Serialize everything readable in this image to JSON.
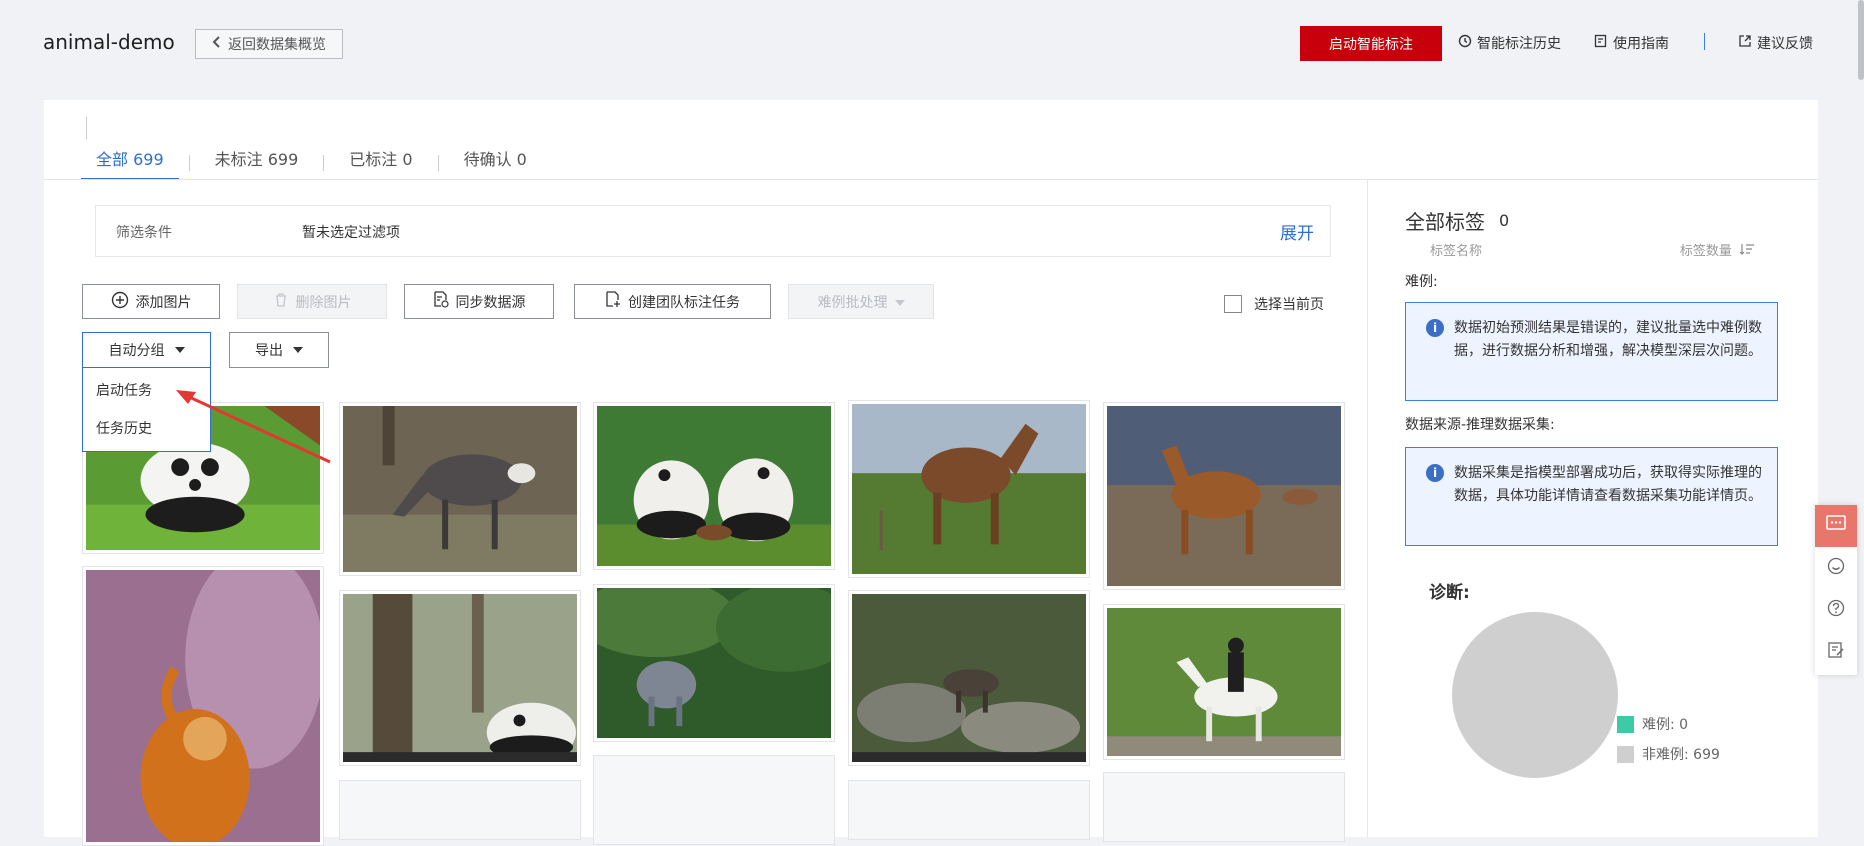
{
  "header": {
    "app_title": "animal-demo",
    "back_label": "返回数据集概览",
    "start_smart_label": "启动智能标注",
    "history_label": "智能标注历史",
    "guide_label": "使用指南",
    "feedback_label": "建议反馈"
  },
  "tabs": [
    {
      "label": "全部 699",
      "active": true
    },
    {
      "label": "未标注 699",
      "active": false
    },
    {
      "label": "已标注 0",
      "active": false
    },
    {
      "label": "待确认 0",
      "active": false
    }
  ],
  "filter": {
    "label": "筛选条件",
    "value": "暂未选定过滤项",
    "expand_label": "展开"
  },
  "toolbar": {
    "add_image": "添加图片",
    "delete_image": "删除图片",
    "sync_source": "同步数据源",
    "create_team_task": "创建团队标注任务",
    "hard_batch": "难例批处理",
    "select_page": "选择当前页",
    "auto_group": "自动分组",
    "export": "导出"
  },
  "menu": {
    "items": [
      "启动任务",
      "任务历史"
    ]
  },
  "images": [
    {
      "subject": "panda"
    },
    {
      "subject": "muntjac"
    },
    {
      "subject": "two-pandas"
    },
    {
      "subject": "horse-brown"
    },
    {
      "subject": "horse-chestnut"
    },
    {
      "subject": "golden-monkey"
    },
    {
      "subject": "panda-forest"
    },
    {
      "subject": "serow-forest"
    },
    {
      "subject": "muntjac-rocks"
    },
    {
      "subject": "white-horse-rider"
    }
  ],
  "right_panel": {
    "title": "全部标签",
    "count": "0",
    "col_name": "标签名称",
    "col_count": "标签数量",
    "hard_title": "难例:",
    "hard_info": "数据初始预测结果是错误的，建议批量选中难例数据，进行数据分析和增强，解决模型深层次问题。",
    "source_title": "数据来源-推理数据采集:",
    "source_info": "数据采集是指模型部署成功后，获取得实际推理的数据，具体功能详情请查看数据采集功能详情页。",
    "diag_title": "诊断:",
    "legend_hard": "难例: 0",
    "legend_non_hard": "非难例: 699"
  },
  "colors": {
    "primary": "#c7000b",
    "link": "#2f6fd4",
    "info_border": "#3a7ee8",
    "legend_hard": "#3ec9a7",
    "legend_non_hard": "#cfcfcf",
    "annotation_arrow": "#e3372f"
  },
  "chart_data": {
    "type": "pie",
    "categories": [
      "难例",
      "非难例"
    ],
    "values": [
      0,
      699
    ]
  }
}
